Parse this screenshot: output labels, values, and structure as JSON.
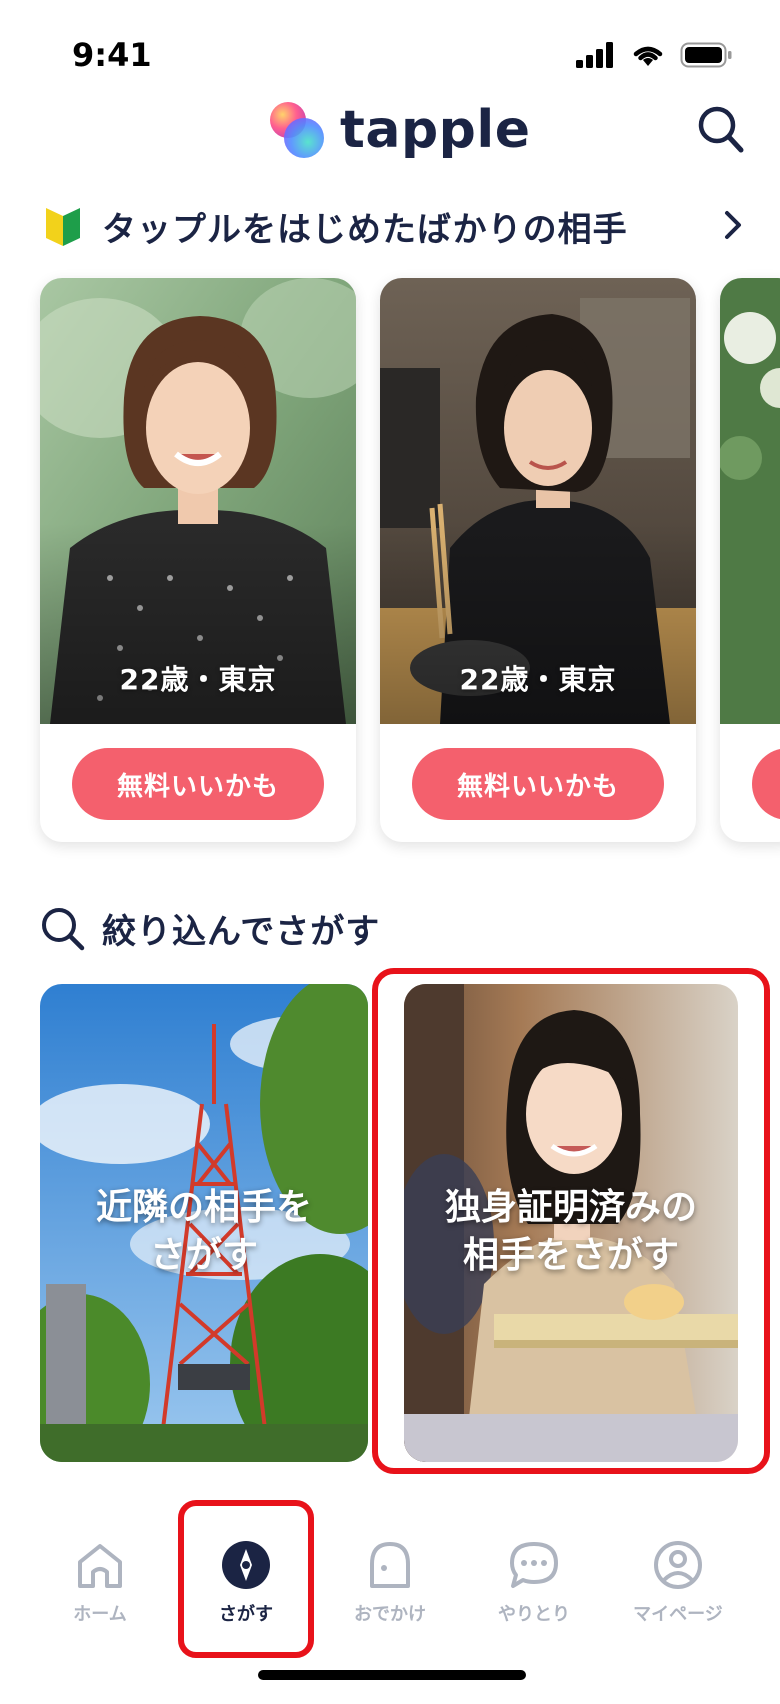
{
  "status_bar": {
    "time": "9:41"
  },
  "header": {
    "logo_text": "tapple"
  },
  "section_new_users": {
    "title": "タップルをはじめたばかりの相手",
    "cards": [
      {
        "info": "22歳・東京",
        "button_label": "無料いいかも"
      },
      {
        "info": "22歳・東京",
        "button_label": "無料いいかも"
      }
    ]
  },
  "section_search": {
    "title": "絞り込んでさがす",
    "cards": [
      {
        "line1": "近隣の相手を",
        "line2": "さがす"
      },
      {
        "line1": "独身証明済みの",
        "line2": "相手をさがす"
      }
    ]
  },
  "bottom_nav": {
    "items": [
      {
        "label": "ホーム",
        "icon": "home-icon"
      },
      {
        "label": "さがす",
        "icon": "compass-icon",
        "active": true
      },
      {
        "label": "おでかけ",
        "icon": "outing-icon"
      },
      {
        "label": "やりとり",
        "icon": "chat-icon"
      },
      {
        "label": "マイページ",
        "icon": "profile-icon"
      }
    ]
  },
  "colors": {
    "primary_text": "#1b2444",
    "like_button": "#f4606d",
    "highlight_box": "#e8121a",
    "inactive_nav": "#aeb4c0"
  }
}
